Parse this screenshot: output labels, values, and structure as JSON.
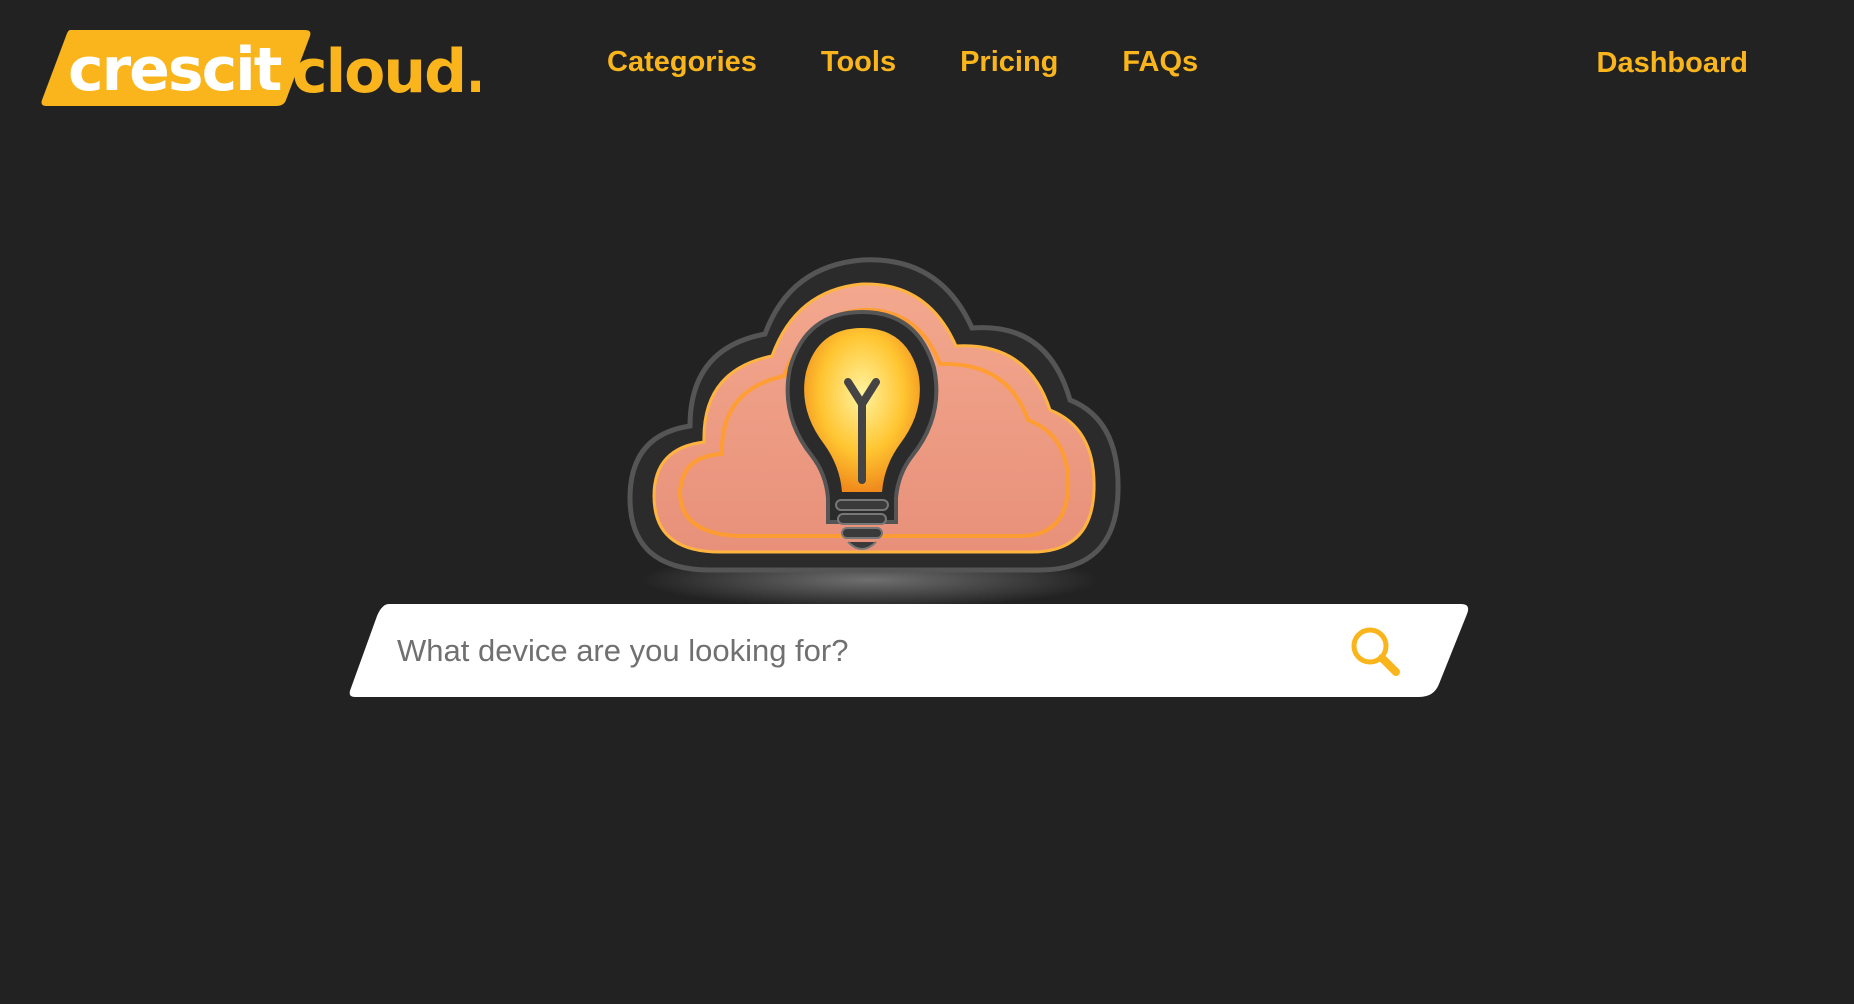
{
  "brand": {
    "logo_primary": "crescit",
    "logo_secondary": "cloud.",
    "accent_color": "#f9b51b",
    "background_color": "#222222"
  },
  "nav": {
    "items": [
      {
        "label": "Categories"
      },
      {
        "label": "Tools"
      },
      {
        "label": "Pricing"
      },
      {
        "label": "FAQs"
      }
    ],
    "dashboard_label": "Dashboard"
  },
  "hero": {
    "illustration": "cloud-lightbulb-icon"
  },
  "search": {
    "placeholder": "What device are you looking for?",
    "value": "",
    "icon": "search-icon"
  }
}
